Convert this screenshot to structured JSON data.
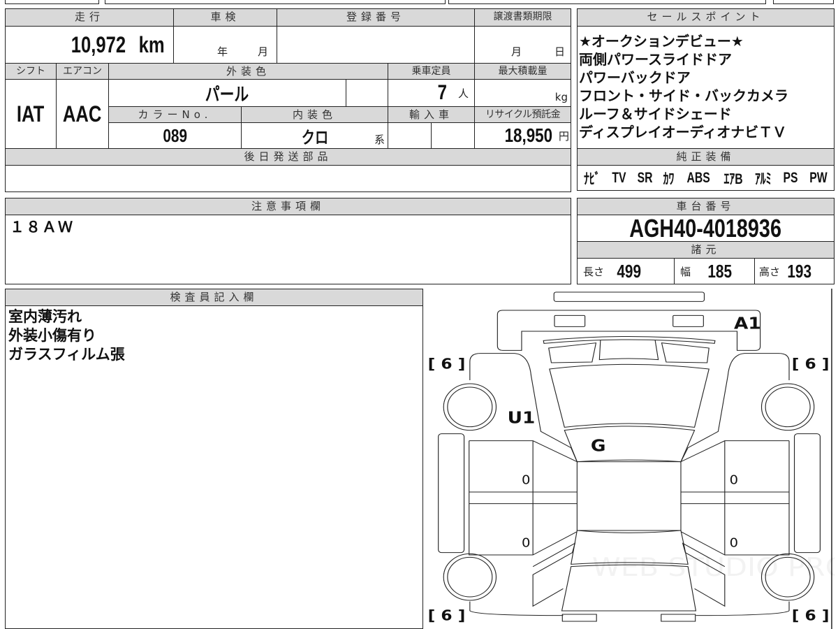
{
  "vehicle": {
    "mileage": "10,972",
    "mileage_unit": "km",
    "inspection_year_label": "年",
    "inspection_month_label": "月",
    "doc_month_label": "月",
    "doc_day_label": "日",
    "shift": "IAT",
    "aircon": "AAC",
    "exterior_color": "パール",
    "capacity": "7",
    "capacity_unit": "人",
    "load_unit": "kg",
    "color_no": "089",
    "interior_color": "クロ",
    "interior_suffix": "系",
    "recycle_fee": "18,950",
    "recycle_unit": "円"
  },
  "headers": {
    "mileage": "走行",
    "inspection": "車検",
    "registration": "登録番号",
    "transfer_deadline": "譲渡書類期限",
    "shift": "シフト",
    "aircon": "エアコン",
    "exterior_color": "外装色",
    "capacity": "乗車定員",
    "max_load": "最大積載量",
    "color_no": "カラーNo.",
    "interior_color": "内装色",
    "import": "輸入車",
    "recycle": "リサイクル預託金",
    "later_parts": "後日発送部品",
    "sales_points": "セールスポイント",
    "equipment": "純正装備",
    "notes": "注意事項欄",
    "chassis": "車台番号",
    "specs": "諸元",
    "inspector": "検査員記入欄"
  },
  "sales_points": [
    "★オークションデビュー★",
    "両側パワースライドドア",
    "パワーバックドア",
    "フロント・サイド・バックカメラ",
    "ルーフ＆サイドシェード",
    "ディスプレイオーディオナビＴＶ"
  ],
  "equipment": [
    "ﾅﾋﾞ",
    "TV",
    "SR",
    "ｶﾜ",
    "ABS",
    "ｴｱB",
    "ｱﾙﾐ",
    "PS",
    "PW"
  ],
  "notes": "１８ＡＷ",
  "chassis_number": "AGH40-4018936",
  "specs": {
    "length_label": "長さ",
    "length": "499",
    "width_label": "幅",
    "width": "185",
    "height_label": "高さ",
    "height": "193"
  },
  "inspector_notes": [
    "室内薄汚れ",
    "外装小傷有り",
    "ガラスフィルム張"
  ],
  "diagram": {
    "marks": {
      "front": "A1",
      "left_front_door": "U1",
      "windshield": "G",
      "lf_door": "0",
      "lr_door": "0",
      "rf_door": "0",
      "rr_door": "0"
    },
    "tires": {
      "front_left": "[ 6 ]",
      "front_right": "[ 6 ]",
      "rear_left": "[ 6 ]",
      "rear_right": "[ 6 ]"
    },
    "watermark": "WEB STUDIO PRO"
  }
}
